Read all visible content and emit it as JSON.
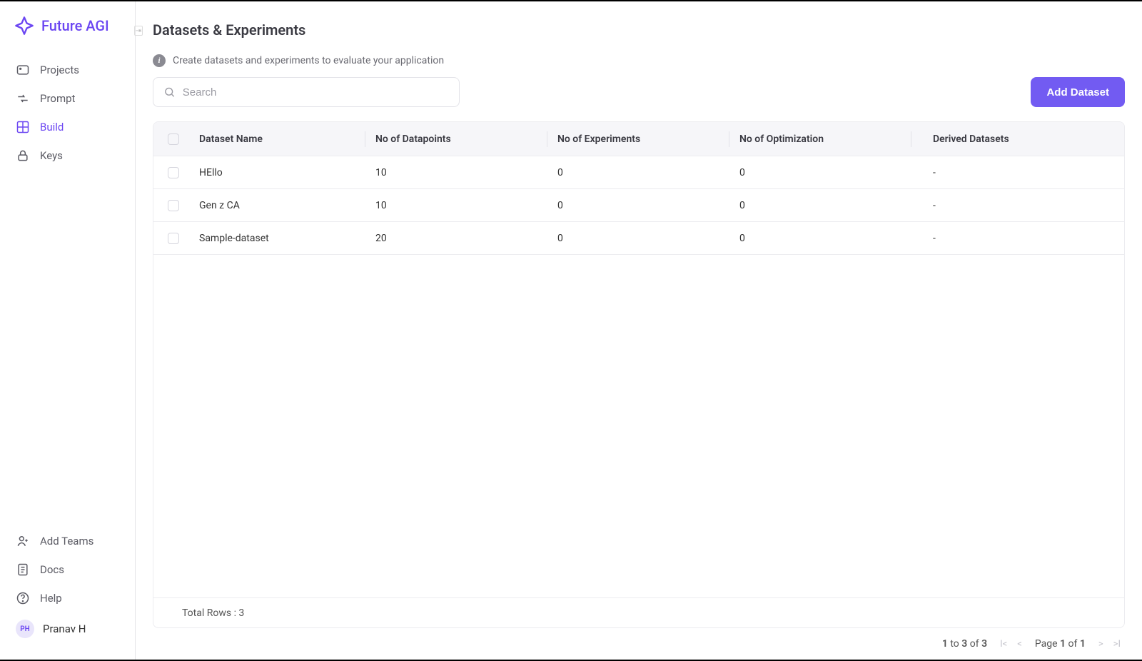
{
  "brand": {
    "name": "Future AGI"
  },
  "sidebar": {
    "items": [
      {
        "label": "Projects"
      },
      {
        "label": "Prompt"
      },
      {
        "label": "Build"
      },
      {
        "label": "Keys"
      }
    ],
    "bottom": [
      {
        "label": "Add Teams"
      },
      {
        "label": "Docs"
      },
      {
        "label": "Help"
      }
    ],
    "user": {
      "initials": "PH",
      "name": "Pranav H"
    }
  },
  "page": {
    "title": "Datasets & Experiments",
    "info": "Create datasets and experiments to evaluate your application"
  },
  "search": {
    "placeholder": "Search"
  },
  "actions": {
    "add_dataset": "Add Dataset"
  },
  "table": {
    "columns": {
      "name": "Dataset Name",
      "datapoints": "No of Datapoints",
      "experiments": "No of Experiments",
      "optimization": "No of Optimization",
      "derived": "Derived Datasets"
    },
    "rows": [
      {
        "name": "HEllo",
        "datapoints": "10",
        "experiments": "0",
        "optimization": "0",
        "derived": "-"
      },
      {
        "name": "Gen z CA",
        "datapoints": "10",
        "experiments": "0",
        "optimization": "0",
        "derived": "-"
      },
      {
        "name": "Sample-dataset",
        "datapoints": "20",
        "experiments": "0",
        "optimization": "0",
        "derived": "-"
      }
    ],
    "footer": "Total Rows : 3"
  },
  "pagination": {
    "range_from": "1",
    "range_to": "3",
    "range_total": "3",
    "to_word": "to",
    "of_word": "of",
    "page_word": "Page",
    "page_current": "1",
    "page_total": "1"
  }
}
